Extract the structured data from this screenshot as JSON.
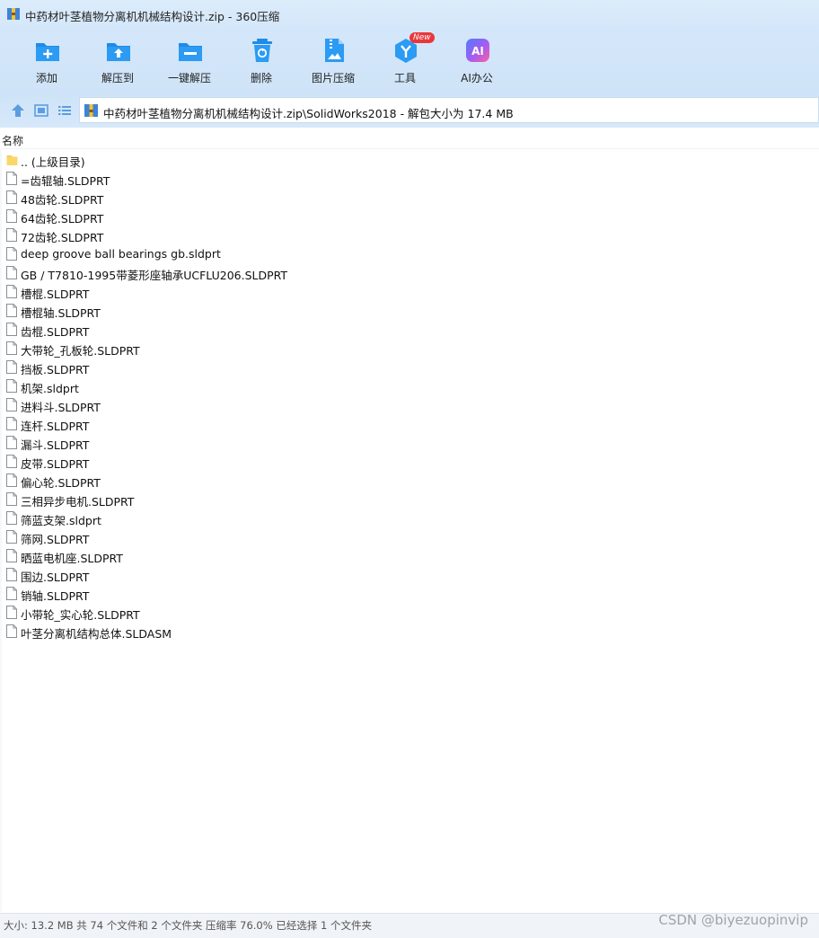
{
  "window": {
    "title": "中药材叶茎植物分离机机械结构设计.zip - 360压缩"
  },
  "toolbar": {
    "items": [
      {
        "label": "添加",
        "icon": "add-icon"
      },
      {
        "label": "解压到",
        "icon": "extract-to-icon"
      },
      {
        "label": "一键解压",
        "icon": "one-click-extract-icon"
      },
      {
        "label": "删除",
        "icon": "delete-icon"
      },
      {
        "label": "图片压缩",
        "icon": "image-compress-icon"
      },
      {
        "label": "工具",
        "icon": "tools-icon",
        "badge": "New"
      },
      {
        "label": "AI办公",
        "icon": "ai-office-icon",
        "icon_text": "AI"
      }
    ]
  },
  "nav": {
    "path": "中药材叶茎植物分离机机械结构设计.zip\\SolidWorks2018 - 解包大小为 17.4 MB"
  },
  "list": {
    "column_name": "名称",
    "files": [
      {
        "name": ".. (上级目录)",
        "type": "folder"
      },
      {
        "name": "=齿辊轴.SLDPRT",
        "type": "file"
      },
      {
        "name": "48齿轮.SLDPRT",
        "type": "file"
      },
      {
        "name": "64齿轮.SLDPRT",
        "type": "file"
      },
      {
        "name": "72齿轮.SLDPRT",
        "type": "file"
      },
      {
        "name": "deep groove ball bearings gb.sldprt",
        "type": "file"
      },
      {
        "name": "GB / T7810-1995带菱形座轴承UCFLU206.SLDPRT",
        "type": "file"
      },
      {
        "name": "槽棍.SLDPRT",
        "type": "file"
      },
      {
        "name": "槽棍轴.SLDPRT",
        "type": "file"
      },
      {
        "name": "齿棍.SLDPRT",
        "type": "file"
      },
      {
        "name": "大带轮_孔板轮.SLDPRT",
        "type": "file"
      },
      {
        "name": "挡板.SLDPRT",
        "type": "file"
      },
      {
        "name": "机架.sldprt",
        "type": "file"
      },
      {
        "name": "进料斗.SLDPRT",
        "type": "file"
      },
      {
        "name": "连杆.SLDPRT",
        "type": "file"
      },
      {
        "name": "漏斗.SLDPRT",
        "type": "file"
      },
      {
        "name": "皮带.SLDPRT",
        "type": "file"
      },
      {
        "name": "偏心轮.SLDPRT",
        "type": "file"
      },
      {
        "name": "三相异步电机.SLDPRT",
        "type": "file"
      },
      {
        "name": "筛蓝支架.sldprt",
        "type": "file"
      },
      {
        "name": "筛网.SLDPRT",
        "type": "file"
      },
      {
        "name": "晒蓝电机座.SLDPRT",
        "type": "file"
      },
      {
        "name": "围边.SLDPRT",
        "type": "file"
      },
      {
        "name": "销轴.SLDPRT",
        "type": "file"
      },
      {
        "name": "小带轮_实心轮.SLDPRT",
        "type": "file"
      },
      {
        "name": "叶茎分离机结构总体.SLDASM",
        "type": "file"
      }
    ]
  },
  "status": {
    "text": "大小: 13.2 MB 共 74 个文件和 2 个文件夹 压缩率 76.0% 已经选择 1 个文件夹"
  },
  "watermark": "CSDN @biyezuopinvip",
  "colors": {
    "accent": "#1e8be6",
    "toolbar_bg": "#d4e7fa",
    "folder": "#f7cc57"
  }
}
